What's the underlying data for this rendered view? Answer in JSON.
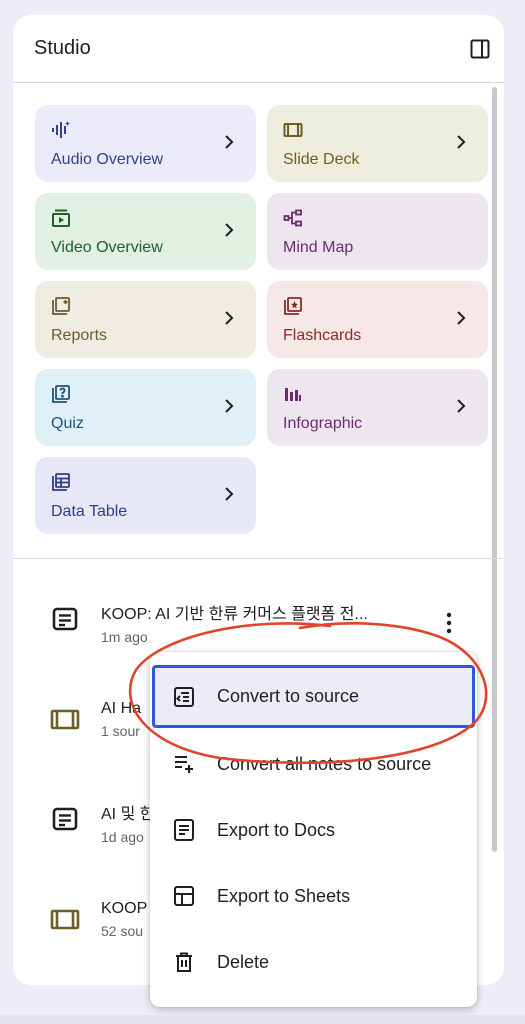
{
  "header": {
    "title": "Studio"
  },
  "cards": [
    {
      "label": "Audio Overview",
      "icon": "audio-waveform-icon",
      "chevron": true,
      "bg": "#ebebfa",
      "fg": "#33408c"
    },
    {
      "label": "Slide Deck",
      "icon": "slide-deck-icon",
      "chevron": true,
      "bg": "#eeeedf",
      "fg": "#6b5f23"
    },
    {
      "label": "Video Overview",
      "icon": "video-icon",
      "chevron": true,
      "bg": "#e2efe3",
      "fg": "#1f5f2c"
    },
    {
      "label": "Mind Map",
      "icon": "mind-map-icon",
      "chevron": false,
      "bg": "#ede6ee",
      "fg": "#6e2b6f"
    },
    {
      "label": "Reports",
      "icon": "reports-icon",
      "chevron": true,
      "bg": "#efede3",
      "fg": "#6b5a32"
    },
    {
      "label": "Flashcards",
      "icon": "flashcards-icon",
      "chevron": true,
      "bg": "#f6e8e6",
      "fg": "#8b2a2a"
    },
    {
      "label": "Quiz",
      "icon": "quiz-icon",
      "chevron": true,
      "bg": "#e1eff6",
      "fg": "#1e5678"
    },
    {
      "label": "Infographic",
      "icon": "infographic-icon",
      "chevron": true,
      "bg": "#eee6ef",
      "fg": "#6e2b6f"
    },
    {
      "label": "Data Table",
      "icon": "data-table-icon",
      "chevron": true,
      "bg": "#e6e8f8",
      "fg": "#2f3c8a"
    }
  ],
  "notes": [
    {
      "title": "KOOP: AI 기반 한류 커머스 플랫폼 전...",
      "meta": "1m ago",
      "icon": "note-icon"
    },
    {
      "title": "AI Ha",
      "meta": "1 sour",
      "icon": "slide-deck-icon"
    },
    {
      "title": "AI 및 한",
      "meta": "1d ago",
      "icon": "note-icon"
    },
    {
      "title": "KOOP",
      "meta": "52 sou",
      "icon": "slide-deck-icon"
    }
  ],
  "menu": {
    "items": [
      {
        "label": "Convert to source",
        "icon": "convert-to-source-icon",
        "active": true
      },
      {
        "label": "Convert all notes to source",
        "icon": "playlist-add-icon",
        "active": false
      },
      {
        "label": "Export to Docs",
        "icon": "docs-icon",
        "active": false
      },
      {
        "label": "Export to Sheets",
        "icon": "sheets-icon",
        "active": false
      },
      {
        "label": "Delete",
        "icon": "trash-icon",
        "active": false
      }
    ]
  },
  "colors": {
    "highlight_border": "#3356e0",
    "annotation_circle": "#e0442a"
  }
}
